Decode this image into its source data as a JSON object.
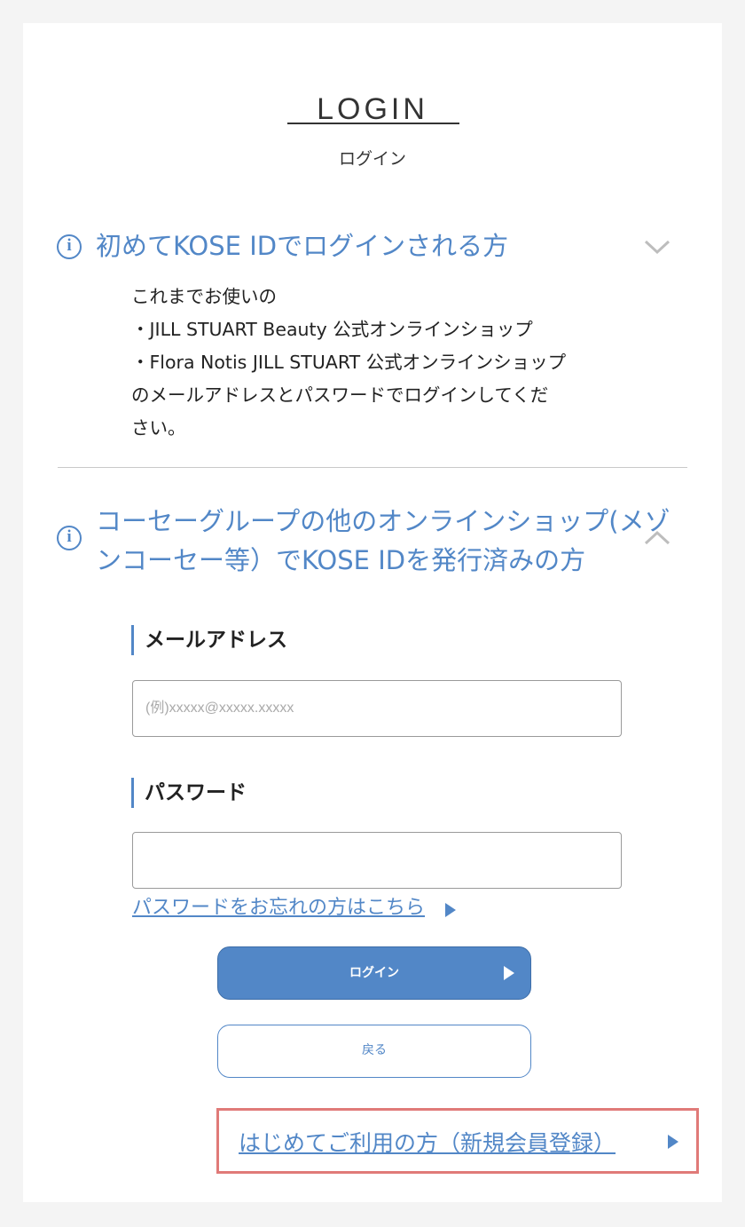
{
  "header": {
    "title": "LOGIN",
    "subtitle": "ログイン"
  },
  "accordion1": {
    "title": "初めてKOSE IDでログインされる方",
    "icon": "info-icon",
    "state": "collapsed",
    "description": [
      "これまでお使いの",
      "・JILL STUART Beauty 公式オンラインショップ",
      "・Flora Notis JILL STUART 公式オンラインショップ",
      "のメールアドレスとパスワードでログインしてくだ",
      "さい。"
    ]
  },
  "accordion2": {
    "title_line1": "コーセーグループの他のオンラインショップ(メゾ",
    "title_line2": "ンコーセー等）でKOSE IDを発行済みの方",
    "icon": "info-icon",
    "state": "expanded"
  },
  "form": {
    "email_label": "メールアドレス",
    "email_placeholder": "(例)xxxxx@xxxxx.xxxxx",
    "email_value": "",
    "password_label": "パスワード",
    "password_value": "",
    "forgot_link": "パスワードをお忘れの方はこちら",
    "login_button": "ログイン",
    "back_button": "戻る"
  },
  "register": {
    "link": "はじめてご利用の方（新規会員登録）"
  },
  "colors": {
    "accent": "#5287c7",
    "highlight_border": "#e07a78",
    "background": "#f4f4f4"
  }
}
